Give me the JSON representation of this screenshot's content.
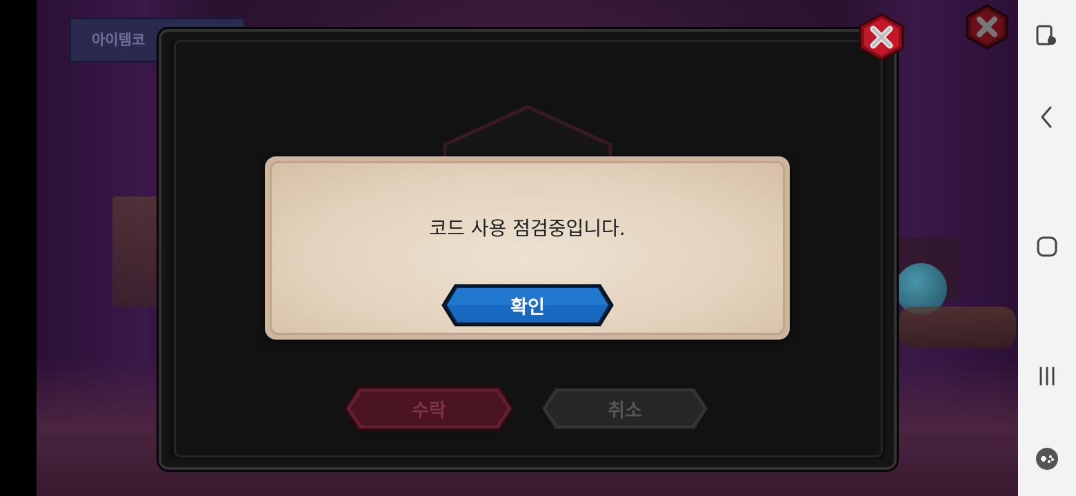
{
  "background": {
    "item_code_tab": "아이템코"
  },
  "panel": {
    "accept_label": "수락",
    "cancel_label": "취소"
  },
  "dialog": {
    "message": "코드 사용 점검중입니다.",
    "confirm_label": "확인"
  },
  "colors": {
    "confirm_button": "#1769c0",
    "accept_button": "#5a1a2a",
    "cancel_button": "#2e2e2e",
    "dialog_bg": "#e6d6c2",
    "close_red": "#b3141e"
  },
  "navbar": {
    "icons": [
      "screen-touch-icon",
      "back-icon",
      "home-icon",
      "recent-apps-icon",
      "game-tools-icon"
    ]
  }
}
